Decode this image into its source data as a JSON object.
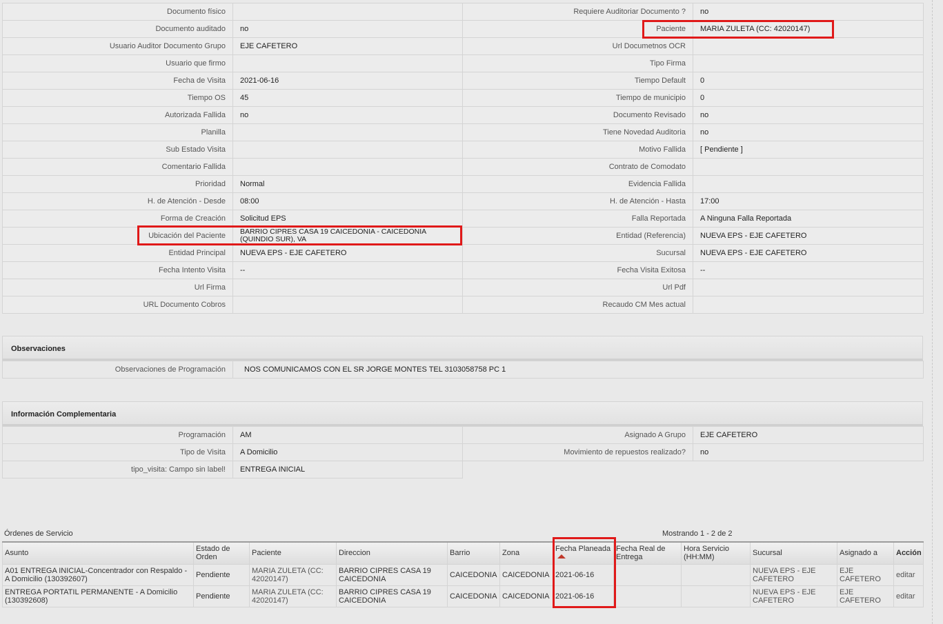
{
  "details": [
    {
      "l1": "Documento físico",
      "v1": "",
      "l2": "Requiere Auditoriar Documento ?",
      "v2": "no"
    },
    {
      "l1": "Documento auditado",
      "v1": "no",
      "l2": "Paciente",
      "v2": "MARIA ZULETA (CC: 42020147)"
    },
    {
      "l1": "Usuario Auditor Documento Grupo",
      "v1": "EJE CAFETERO",
      "l2": "Url Documetnos OCR",
      "v2": ""
    },
    {
      "l1": "Usuario que firmo",
      "v1": "",
      "l2": "Tipo Firma",
      "v2": ""
    },
    {
      "l1": "Fecha de Visita",
      "v1": "2021-06-16",
      "l2": "Tiempo Default",
      "v2": "0"
    },
    {
      "l1": "Tiempo OS",
      "v1": "45",
      "l2": "Tiempo de municipio",
      "v2": "0"
    },
    {
      "l1": "Autorizada Fallida",
      "v1": "no",
      "l2": "Documento Revisado",
      "v2": "no"
    },
    {
      "l1": "Planilla",
      "v1": "",
      "l2": "Tiene Novedad Auditoria",
      "v2": "no"
    },
    {
      "l1": "Sub Estado Visita",
      "v1": "",
      "l2": "Motivo Fallida",
      "v2": "[ Pendiente ]"
    },
    {
      "l1": "Comentario Fallida",
      "v1": "",
      "l2": "Contrato de Comodato",
      "v2": ""
    },
    {
      "l1": "Prioridad",
      "v1": "Normal",
      "l2": "Evidencia Fallida",
      "v2": ""
    },
    {
      "l1": "H. de Atención - Desde",
      "v1": "08:00",
      "l2": "H. de Atención - Hasta",
      "v2": "17:00"
    },
    {
      "l1": "Forma de Creación",
      "v1": "Solicitud EPS",
      "l2": "Falla Reportada",
      "v2": "A Ninguna Falla Reportada"
    },
    {
      "l1": "Ubicación del Paciente",
      "v1": "BARRIO CIPRES CASA 19 CAICEDONIA - CAICEDONIA (QUINDIO SUR), VA",
      "l2": "Entidad (Referencia)",
      "v2": "NUEVA EPS - EJE CAFETERO"
    },
    {
      "l1": "Entidad Principal",
      "v1": "NUEVA EPS - EJE CAFETERO",
      "l2": "Sucursal",
      "v2": "NUEVA EPS - EJE CAFETERO"
    },
    {
      "l1": "Fecha Intento Visita",
      "v1": "--",
      "l2": "Fecha Visita Exitosa",
      "v2": "--"
    },
    {
      "l1": "Url Firma",
      "v1": "",
      "l2": "Url Pdf",
      "v2": ""
    },
    {
      "l1": "URL Documento Cobros",
      "v1": "",
      "l2": "Recaudo CM Mes actual",
      "v2": ""
    }
  ],
  "observaciones": {
    "title": "Observaciones",
    "label": "Observaciones de Programación",
    "value": "NOS COMUNICAMOS CON EL SR JORGE MONTES TEL 3103058758 PC 1"
  },
  "complementaria": {
    "title": "Información Complementaria",
    "rows": [
      {
        "l1": "Programación",
        "v1": "AM",
        "l2": "Asignado A Grupo",
        "v2": "EJE CAFETERO"
      },
      {
        "l1": "Tipo de Visita",
        "v1": "A Domicilio",
        "l2": "Movimiento de repuestos realizado?",
        "v2": "no"
      },
      {
        "l1": "tipo_visita: Campo sin label!",
        "v1": "ENTREGA INICIAL"
      }
    ]
  },
  "orders": {
    "title": "Órdenes de Servicio",
    "count": "Mostrando 1 - 2 de 2",
    "columns": [
      "Asunto",
      "Estado de Orden",
      "Paciente",
      "Direccion",
      "Barrio",
      "Zona",
      "Fecha Planeada",
      "Fecha Real de Entrega",
      "Hora Servicio (HH:MM)",
      "Sucursal",
      "Asignado a",
      "Acción"
    ],
    "rows": [
      {
        "asunto": "A01 ENTREGA INICIAL-Concentrador con Respaldo - A Domicilio (130392607)",
        "estado": "Pendiente",
        "paciente": "MARIA ZULETA (CC: 42020147)",
        "direccion": "BARRIO CIPRES CASA 19 CAICEDONIA",
        "barrio": "CAICEDONIA",
        "zona": "CAICEDONIA",
        "fecha": "2021-06-16",
        "fecha_real": "",
        "hora": "",
        "sucursal": "NUEVA EPS - EJE CAFETERO",
        "asignado": "EJE CAFETERO",
        "accion": "editar"
      },
      {
        "asunto": "ENTREGA PORTATIL PERMANENTE - A Domicilio (130392608)",
        "estado": "Pendiente",
        "paciente": "MARIA ZULETA (CC: 42020147)",
        "direccion": "BARRIO CIPRES CASA 19 CAICEDONIA",
        "barrio": "CAICEDONIA",
        "zona": "CAICEDONIA",
        "fecha": "2021-06-16",
        "fecha_real": "",
        "hora": "",
        "sucursal": "NUEVA EPS - EJE CAFETERO",
        "asignado": "EJE CAFETERO",
        "accion": "editar"
      }
    ]
  },
  "highlight_color": "#e01919"
}
